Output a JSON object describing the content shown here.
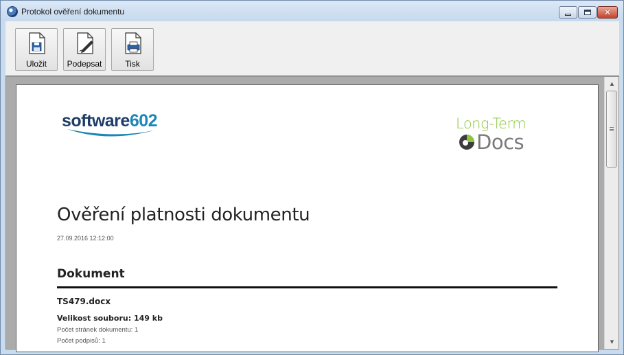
{
  "window": {
    "title": "Protokol ověření dokumentu"
  },
  "toolbar": {
    "save_label": "Uložit",
    "sign_label": "Podepsat",
    "print_label": "Tisk"
  },
  "document": {
    "logo_left_word": "software",
    "logo_left_number": "602",
    "logo_right_line1": "Long-Term",
    "logo_right_line2": "Docs",
    "title": "Ověření platnosti dokumentu",
    "date": "27.09.2016 12:12:00",
    "section_heading": "Dokument",
    "file_name": "TS479.docx",
    "file_size": "Velikost souboru: 149 kb",
    "pages_count": "Počet stránek dokumentu: 1",
    "signatures_count": "Počet podpisů: 1"
  },
  "colors": {
    "brand_navy": "#1f3d68",
    "brand_blue": "#1c86b8",
    "ltd_green": "#8cc63f",
    "ltd_gray": "#7a7a7a"
  }
}
